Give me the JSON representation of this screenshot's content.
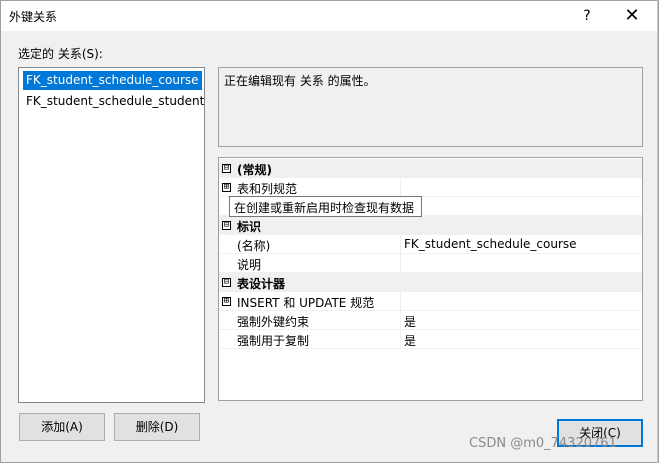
{
  "window": {
    "title": "外键关系",
    "help_glyph": "?",
    "close_glyph": "✕"
  },
  "relations": {
    "label": "选定的 关系(S):",
    "items": [
      {
        "label": "FK_student_schedule_course",
        "selected": true
      },
      {
        "label": "FK_student_schedule_student",
        "selected": false
      }
    ]
  },
  "description": "正在编辑现有 关系 的属性。",
  "grid": {
    "rows": [
      {
        "kind": "category",
        "toggle": "⊟",
        "name": "(常规)",
        "value": ""
      },
      {
        "kind": "property",
        "toggle": "⊞",
        "name": "表和列规范",
        "value": ""
      },
      {
        "kind": "property",
        "toggle": "",
        "name": "",
        "value": ""
      },
      {
        "kind": "category",
        "toggle": "⊟",
        "name": "标识",
        "value": ""
      },
      {
        "kind": "property",
        "toggle": "",
        "name": "(名称)",
        "value": "FK_student_schedule_course"
      },
      {
        "kind": "property",
        "toggle": "",
        "name": "说明",
        "value": ""
      },
      {
        "kind": "category",
        "toggle": "⊟",
        "name": "表设计器",
        "value": ""
      },
      {
        "kind": "property",
        "toggle": "⊞",
        "name": "INSERT 和 UPDATE 规范",
        "value": ""
      },
      {
        "kind": "property",
        "toggle": "",
        "name": "强制外键约束",
        "value": "是"
      },
      {
        "kind": "property",
        "toggle": "",
        "name": "强制用于复制",
        "value": "是"
      }
    ],
    "tooltip": "在创建或重新启用时检查现有数据"
  },
  "buttons": {
    "add": "添加(A)",
    "delete": "删除(D)",
    "close": "关闭(C)"
  },
  "watermark": "CSDN @m0_74320761"
}
